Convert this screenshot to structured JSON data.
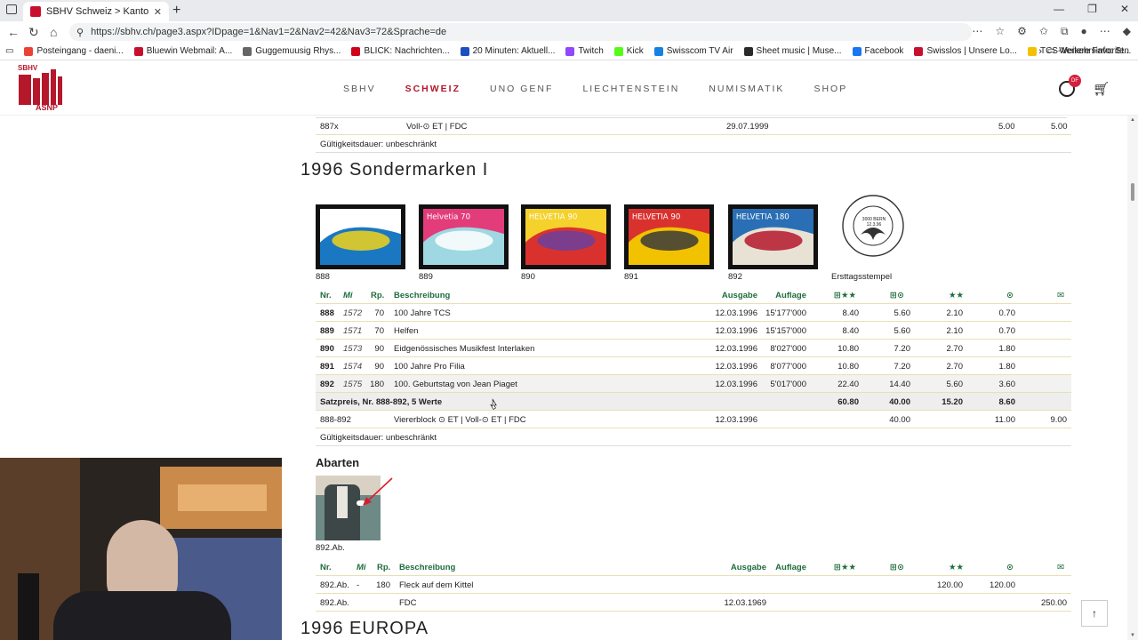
{
  "browser": {
    "tab_title": "SBHV Schweiz > Kantonal- und F",
    "tab_close": "✕",
    "new_tab": "+",
    "url": "https://sbhv.ch/page3.aspx?IDpage=1&Nav1=2&Nav2=42&Nav3=72&Sprache=de",
    "bookmarks": [
      {
        "label": "Posteingang - daeni...",
        "color": "#ea4335"
      },
      {
        "label": "Bluewin Webmail: A...",
        "color": "#c8102e"
      },
      {
        "label": "Guggemuusig Rhys...",
        "color": "#666666"
      },
      {
        "label": "BLICK: Nachrichten...",
        "color": "#d0021b"
      },
      {
        "label": "20 Minuten: Aktuell...",
        "color": "#1e4fc1"
      },
      {
        "label": "Twitch",
        "color": "#9146ff"
      },
      {
        "label": "Kick",
        "color": "#53fc18"
      },
      {
        "label": "Swisscom TV Air",
        "color": "#1781e3"
      },
      {
        "label": "Sheet music | Muse...",
        "color": "#2a2a2a"
      },
      {
        "label": "Facebook",
        "color": "#1877f2"
      },
      {
        "label": "Swisslos | Unsere Lo...",
        "color": "#c8102e"
      },
      {
        "label": "TCS-Verkehrsinfo: St...",
        "color": "#f2c200"
      }
    ],
    "other_favorites": "Weitere Favoriten"
  },
  "site": {
    "logo_top": "SBHV",
    "logo_bottom": "ASNP",
    "nav": [
      "SBHV",
      "SCHWEIZ",
      "UNO GENF",
      "LIECHTENSTEIN",
      "NUMISMATIK",
      "SHOP"
    ],
    "active_nav": "SCHWEIZ",
    "badge": "DF",
    "accent": "#b5172b",
    "header_green": "#1f6d3b"
  },
  "prev_section": {
    "row": {
      "nr": "887x",
      "desc": "Voll-⊙ ET | FDC",
      "date": "29.07.1999",
      "v1": "5.00",
      "v2": "5.00"
    },
    "validity": "Gültigkeitsdauer: unbeschränkt"
  },
  "section": {
    "title": "1996 Sondermarken I",
    "stamps": [
      {
        "label": "888",
        "colors": [
          "#ffffff",
          "#1a78c2",
          "#f2d21b"
        ],
        "text": "HELVETIA"
      },
      {
        "label": "889",
        "colors": [
          "#e23c7a",
          "#9fd8e2",
          "#ffffff"
        ],
        "text": "Helvetia 70"
      },
      {
        "label": "890",
        "colors": [
          "#f5d12b",
          "#d9322e",
          "#6b3f9e"
        ],
        "text": "HELVETIA 90"
      },
      {
        "label": "891",
        "colors": [
          "#d9322e",
          "#f2c200",
          "#3a3a3a"
        ],
        "text": "HELVETIA 90"
      },
      {
        "label": "892",
        "colors": [
          "#2a6fb5",
          "#e8e2d5",
          "#b5172b"
        ],
        "text": "HELVETIA 180"
      }
    ],
    "postmark_label": "Ersttagsstempel",
    "postmark_text": "3000 BERN 12.3.96",
    "headers": {
      "nr": "Nr.",
      "mi": "Mi",
      "rp": "Rp.",
      "desc": "Beschreibung",
      "ausgabe": "Ausgabe",
      "auflage": "Auflage",
      "c1": "⊞★★",
      "c2": "⊞⊙",
      "c3": "★★",
      "c4": "⊙",
      "c5": "✉"
    },
    "rows": [
      {
        "nr": "888",
        "mi": "1572",
        "rp": "70",
        "desc": "100 Jahre TCS",
        "ausgabe": "12.03.1996",
        "auflage": "15'177'000",
        "c1": "8.40",
        "c2": "5.60",
        "c3": "2.10",
        "c4": "0.70",
        "c5": ""
      },
      {
        "nr": "889",
        "mi": "1571",
        "rp": "70",
        "desc": "Helfen",
        "ausgabe": "12.03.1996",
        "auflage": "15'157'000",
        "c1": "8.40",
        "c2": "5.60",
        "c3": "2.10",
        "c4": "0.70",
        "c5": ""
      },
      {
        "nr": "890",
        "mi": "1573",
        "rp": "90",
        "desc": "Eidgenössisches Musikfest Interlaken",
        "ausgabe": "12.03.1996",
        "auflage": "8'027'000",
        "c1": "10.80",
        "c2": "7.20",
        "c3": "2.70",
        "c4": "1.80",
        "c5": ""
      },
      {
        "nr": "891",
        "mi": "1574",
        "rp": "90",
        "desc": "100 Jahre Pro Filia",
        "ausgabe": "12.03.1996",
        "auflage": "8'077'000",
        "c1": "10.80",
        "c2": "7.20",
        "c3": "2.70",
        "c4": "1.80",
        "c5": ""
      },
      {
        "nr": "892",
        "mi": "1575",
        "rp": "180",
        "desc": "100. Geburtstag von Jean Piaget",
        "ausgabe": "12.03.1996",
        "auflage": "5'017'000",
        "c1": "22.40",
        "c2": "14.40",
        "c3": "5.60",
        "c4": "3.60",
        "c5": ""
      }
    ],
    "sum": {
      "label": "Satzpreis, Nr. 888-892, 5 Werte",
      "c1": "60.80",
      "c2": "40.00",
      "c3": "15.20",
      "c4": "8.60"
    },
    "block": {
      "nr": "888-892",
      "desc": "Viererblock ⊙ ET | Voll-⊙ ET | FDC",
      "ausgabe": "12.03.1996",
      "c2": "40.00",
      "c4": "11.00",
      "c5": "9.00"
    },
    "validity": "Gültigkeitsdauer: unbeschränkt"
  },
  "abarten": {
    "title": "Abarten",
    "image_label": "892.Ab.",
    "headers": {
      "nr": "Nr.",
      "mi": "Mi",
      "rp": "Rp.",
      "desc": "Beschreibung",
      "ausgabe": "Ausgabe",
      "auflage": "Auflage",
      "c1": "⊞★★",
      "c2": "⊞⊙",
      "c3": "★★",
      "c4": "⊙",
      "c5": "✉"
    },
    "rows": [
      {
        "nr": "892.Ab.",
        "mi": "-",
        "rp": "180",
        "desc": "Fleck auf dem Kittel",
        "ausgabe": "",
        "c3": "120.00",
        "c4": "120.00",
        "c5": ""
      },
      {
        "nr": "892.Ab.",
        "mi": "",
        "rp": "",
        "desc": "FDC",
        "ausgabe": "12.03.1969",
        "c3": "",
        "c4": "",
        "c5": "250.00"
      }
    ]
  },
  "next_section": {
    "title": "1996 EUROPA"
  }
}
